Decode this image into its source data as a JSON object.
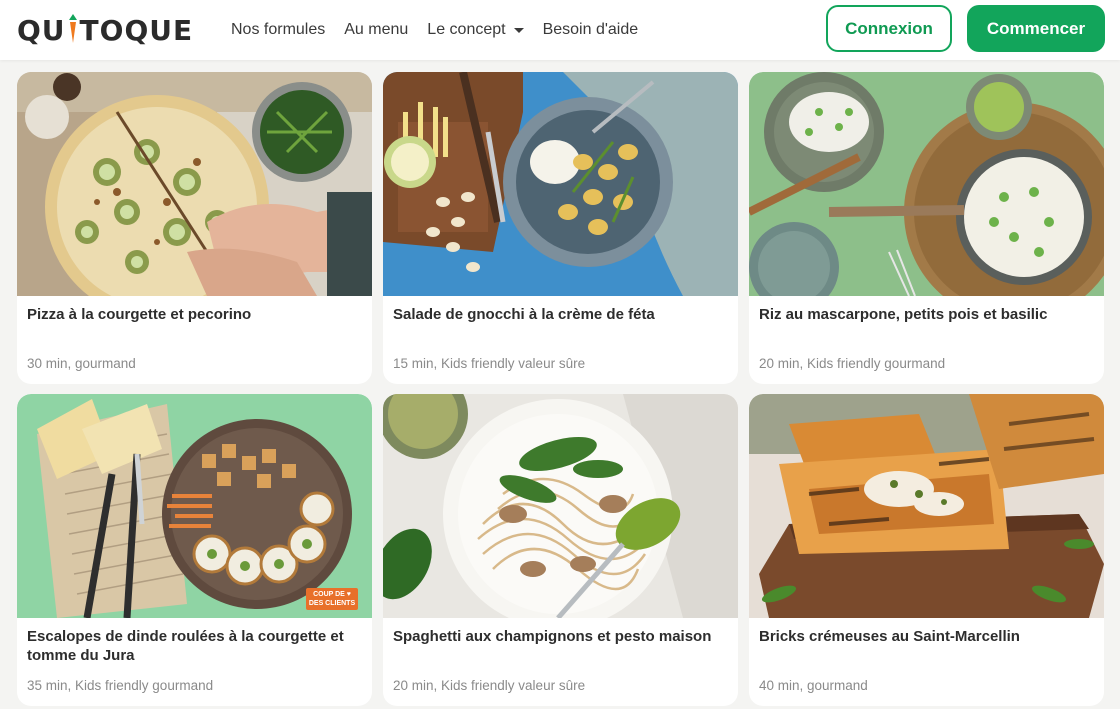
{
  "brand": {
    "name_part1": "QU",
    "name_part2": "TOQUE",
    "accent": "#12a55b",
    "carrot": "#ef7a1f"
  },
  "nav": {
    "items": [
      {
        "label": "Nos formules"
      },
      {
        "label": "Au menu"
      },
      {
        "label": "Le concept"
      },
      {
        "label": "Besoin d'aide"
      }
    ]
  },
  "actions": {
    "login_label": "Connexion",
    "start_label": "Commencer"
  },
  "recipes": [
    {
      "title": "Pizza à la courgette et pecorino",
      "meta": "30 min, gourmand"
    },
    {
      "title": "Salade de gnocchi à la crème de féta",
      "meta": "15 min, Kids friendly valeur sûre"
    },
    {
      "title": "Riz au mascarpone, petits pois et basilic",
      "meta": "20 min, Kids friendly gourmand"
    },
    {
      "title": "Escalopes de dinde roulées à la courgette et tomme du Jura",
      "meta": "35 min, Kids friendly gourmand",
      "badge": "COUP DE ♥ DES CLIENTS"
    },
    {
      "title": "Spaghetti aux champignons et pesto maison",
      "meta": "20 min, Kids friendly valeur sûre"
    },
    {
      "title": "Bricks crémeuses au Saint-Marcellin",
      "meta": "40 min, gourmand"
    }
  ]
}
